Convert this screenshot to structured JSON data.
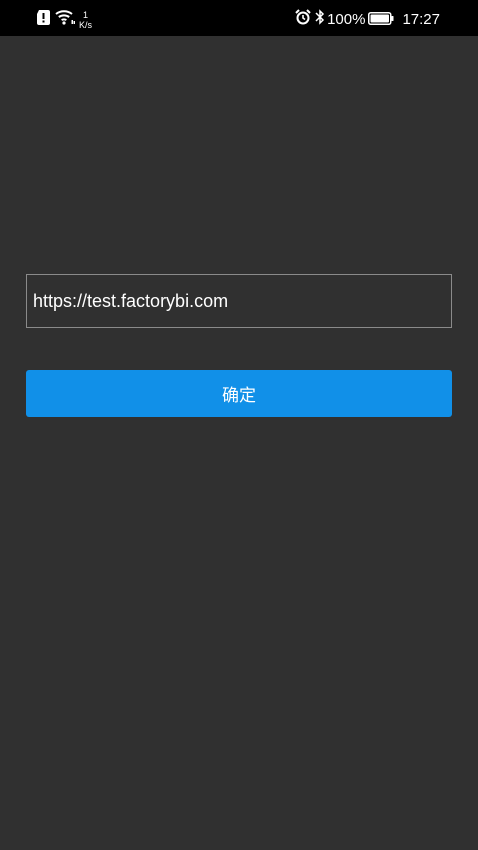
{
  "status_bar": {
    "net_speed_value": "1",
    "net_speed_unit": "K/s",
    "battery_percent": "100%",
    "time": "17:27",
    "icons": [
      "alert-icon",
      "wifi-icon",
      "alarm-icon",
      "bluetooth-icon",
      "battery-icon"
    ]
  },
  "form": {
    "url_value": "https://test.factorybi.com",
    "confirm_label": "确定"
  },
  "colors": {
    "background": "#303030",
    "status_bar": "#000000",
    "button": "#1190e8",
    "input_border": "#8a8a8a"
  }
}
